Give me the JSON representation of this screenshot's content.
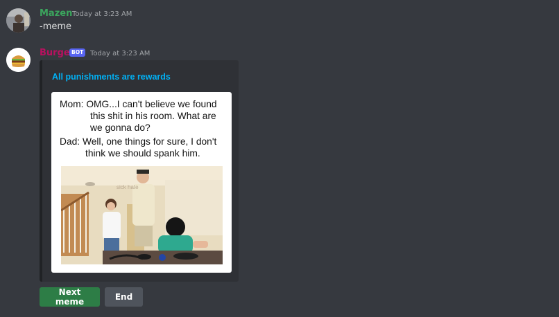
{
  "messages": [
    {
      "username": "Mazen",
      "username_color": "#3ba55d",
      "timestamp": "Today at 3:23 AM",
      "content": "-meme"
    },
    {
      "username": "Burger",
      "username_color": "#b8115f",
      "bot_tag": "BOT",
      "timestamp": "Today at 3:23 AM",
      "embed": {
        "title": "All punishments are rewards",
        "title_color": "#00b0f4",
        "meme_lines": [
          "Mom:  OMG...I can't believe we found",
          "this shit in his room. What are",
          "we gonna do?",
          "Dad:  Well, one things for sure, I don't",
          "think we should spank him."
        ],
        "watermark": "sick hate"
      }
    }
  ],
  "buttons": {
    "next_label": "Next meme",
    "end_label": "End",
    "next_color": "#2d7d46",
    "end_color": "#4f545c"
  },
  "icons": {
    "bot_avatar": "burger-icon",
    "user_avatar": "user-photo-avatar"
  }
}
